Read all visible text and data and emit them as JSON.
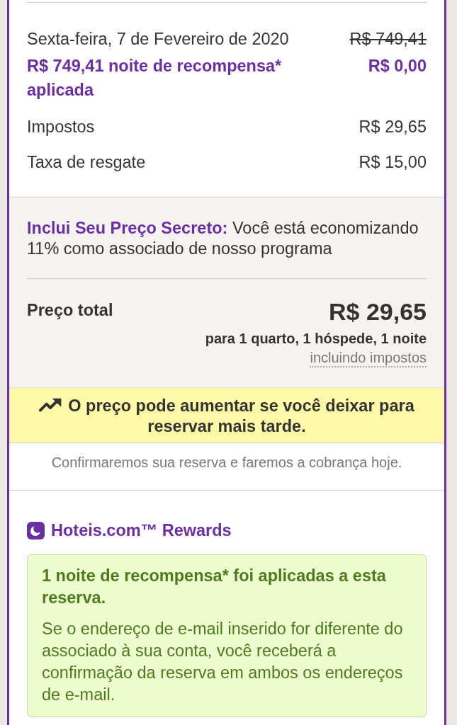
{
  "price_breakdown": {
    "rows": [
      {
        "kind": "night",
        "label": "Sexta-feira, 7 de Fevereiro de 2020",
        "value": "R$ 749,41",
        "struck": true
      },
      {
        "kind": "reward",
        "label": "R$ 749,41 noite de recompensa* aplicada",
        "value": "R$ 0,00",
        "struck": false
      },
      {
        "kind": "plain",
        "label": "Impostos",
        "value": "R$ 29,65",
        "struck": false
      },
      {
        "kind": "plain",
        "label": "Taxa de resgate",
        "value": "R$ 15,00",
        "struck": false
      }
    ]
  },
  "secret_price": {
    "text": "**Inclui Seu Preço Secreto:** Você está economizando 11% como associado de nosso programa"
  },
  "total": {
    "label": "Preço total",
    "amount": "R$ 29,65",
    "details": "para 1 quarto, 1 hóspede, 1 noite",
    "tax_note": "incluindo impostos"
  },
  "price_alert": {
    "text": "O preço pode aumentar se você deixar para reservar mais tarde."
  },
  "confirmation_note": {
    "text": "Confirmaremos sua reserva e faremos a cobrança hoje."
  },
  "rewards": {
    "title": "Hoteis.com™ Rewards",
    "notice": {
      "title": "1 noite de recompensa* foi aplicadas a esta reserva.",
      "body": "Se o endereço de e-mail inserido for diferente do associado à sua conta, você receberá a confirmação da reserva em ambos os endereços de e-mail."
    }
  }
}
